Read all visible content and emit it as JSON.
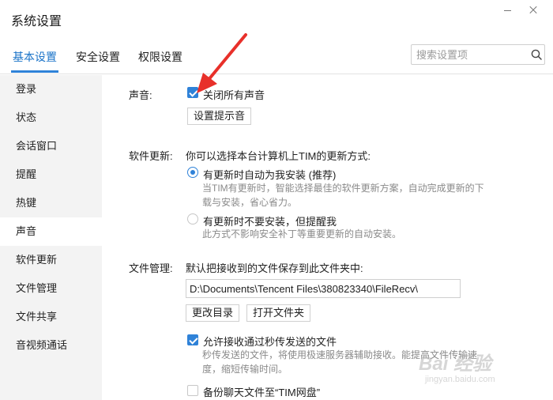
{
  "window": {
    "title": "系统设置",
    "minimize_icon": "minimize-icon",
    "close_icon": "close-icon"
  },
  "tabs": [
    {
      "label": "基本设置",
      "active": true
    },
    {
      "label": "安全设置",
      "active": false
    },
    {
      "label": "权限设置",
      "active": false
    }
  ],
  "search": {
    "placeholder": "搜索设置项",
    "value": "",
    "icon": "search-icon"
  },
  "sidebar": {
    "items": [
      {
        "label": "登录",
        "active": false
      },
      {
        "label": "状态",
        "active": false
      },
      {
        "label": "会话窗口",
        "active": false
      },
      {
        "label": "提醒",
        "active": false
      },
      {
        "label": "热键",
        "active": false
      },
      {
        "label": "声音",
        "active": true
      },
      {
        "label": "软件更新",
        "active": false
      },
      {
        "label": "文件管理",
        "active": false
      },
      {
        "label": "文件共享",
        "active": false
      },
      {
        "label": "音视频通话",
        "active": false
      }
    ]
  },
  "sound": {
    "label": "声音:",
    "mute_all_label": "关闭所有声音",
    "mute_all_checked": true,
    "set_tone_button": "设置提示音"
  },
  "update": {
    "label": "软件更新:",
    "intro": "你可以选择本台计算机上TIM的更新方式:",
    "option_auto_label": "有更新时自动为我安装 (推荐)",
    "option_auto_checked": true,
    "option_auto_desc_line1": "当TIM有更新时，智能选择最佳的软件更新方案，自动完成更新的下",
    "option_auto_desc_line2": "载与安装，省心省力。",
    "option_notify_label": "有更新时不要安装，但提醒我",
    "option_notify_checked": false,
    "option_notify_desc": "此方式不影响安全补丁等重要更新的自动安装。"
  },
  "files": {
    "label": "文件管理:",
    "intro": "默认把接收到的文件保存到此文件夹中:",
    "path": "D:\\Documents\\Tencent Files\\380823340\\FileRecv\\",
    "change_dir_button": "更改目录",
    "open_folder_button": "打开文件夹",
    "allow_instant_label": "允许接收通过秒传发送的文件",
    "allow_instant_checked": true,
    "allow_instant_desc_line1": "秒传发送的文件，将使用极速服务器辅助接收。能提高文件传输速",
    "allow_instant_desc_line2": "度，缩短传输时间。",
    "backup_label": "备份聊天文件至“TIM网盘”",
    "backup_checked": false
  },
  "colors": {
    "accent": "#2f82d8",
    "annotation_arrow": "#e8302a",
    "sidebar_bg": "#f3f3f3"
  },
  "watermark": {
    "logo": "Bai 经验",
    "url": "jingyan.baidu.com"
  }
}
